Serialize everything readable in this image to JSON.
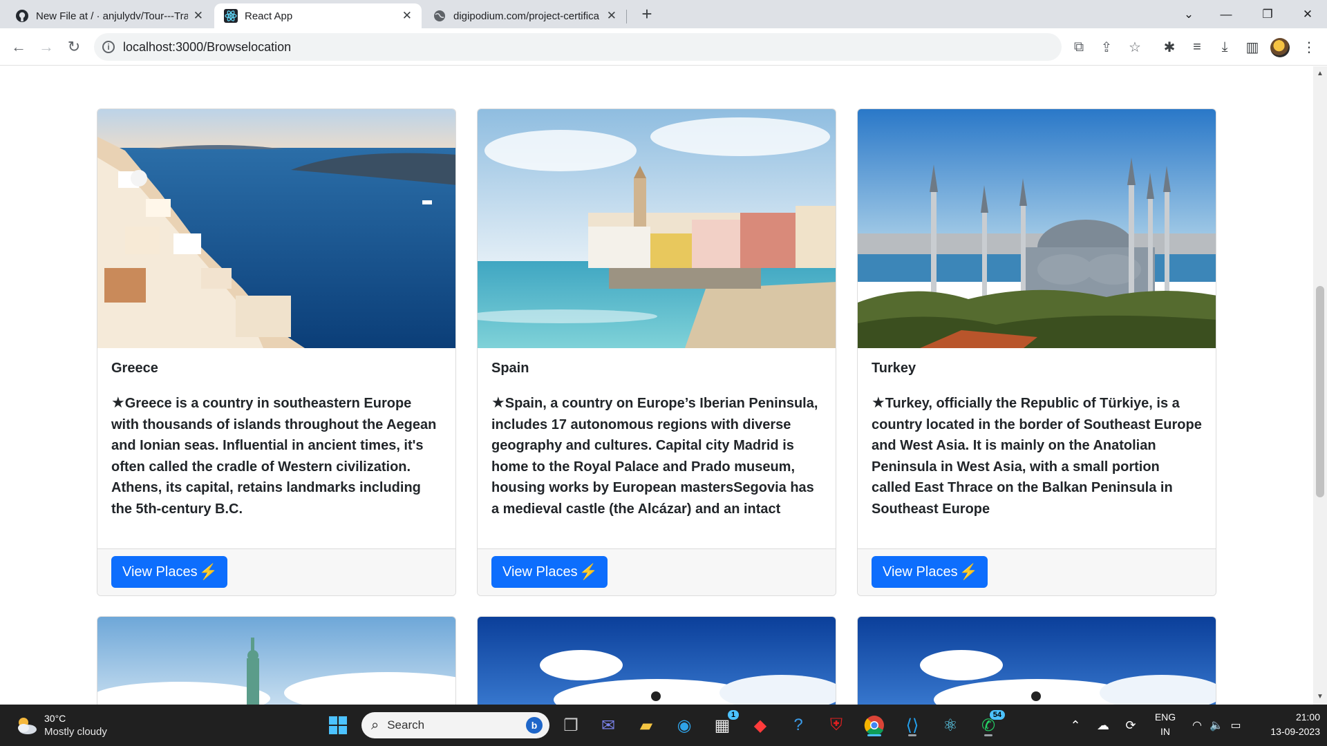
{
  "browser": {
    "tabs": [
      {
        "title": "New File at / · anjulydv/Tour---Tra",
        "icon": "github-icon"
      },
      {
        "title": "React App",
        "icon": "react-icon",
        "active": true
      },
      {
        "title": "digipodium.com/project-certifica",
        "icon": "globe-icon"
      }
    ],
    "address": "localhost:3000/Browselocation"
  },
  "cards": [
    {
      "title": "Greece",
      "star": "★",
      "description": "Greece is a country in southeastern Europe with thousands of islands throughout the Aegean and Ionian seas. Influential in ancient times, it's often called the cradle of Western civilization. Athens, its capital, retains landmarks including the 5th-century B.C.",
      "button": "View Places",
      "bolt": "⚡"
    },
    {
      "title": "Spain",
      "star": "★",
      "description": "Spain, a country on Europe’s Iberian Peninsula, includes 17 autonomous regions with diverse geography and cultures. Capital city Madrid is home to the Royal Palace and Prado museum, housing works by European mastersSegovia has a medieval castle (the Alcázar) and an intact Roman",
      "button": "View Places",
      "bolt": "⚡"
    },
    {
      "title": "Turkey",
      "star": "★",
      "description": "Turkey, officially the Republic of Türkiye, is a country located in the border of Southeast Europe and West Asia. It is mainly on the Anatolian Peninsula in West Asia, with a small portion called East Thrace on the Balkan Peninsula in Southeast Europe",
      "button": "View Places",
      "bolt": "⚡"
    }
  ],
  "taskbar": {
    "temperature": "30°C",
    "weather": "Mostly cloudy",
    "search_placeholder": "Search",
    "store_badge": "1",
    "whatsapp_badge": "54",
    "language": "ENG",
    "region": "IN",
    "time": "21:00",
    "date": "13-09-2023"
  },
  "colors": {
    "primary_button": "#0d6efd",
    "taskbar": "#202020",
    "tab_strip": "#dee1e6"
  }
}
